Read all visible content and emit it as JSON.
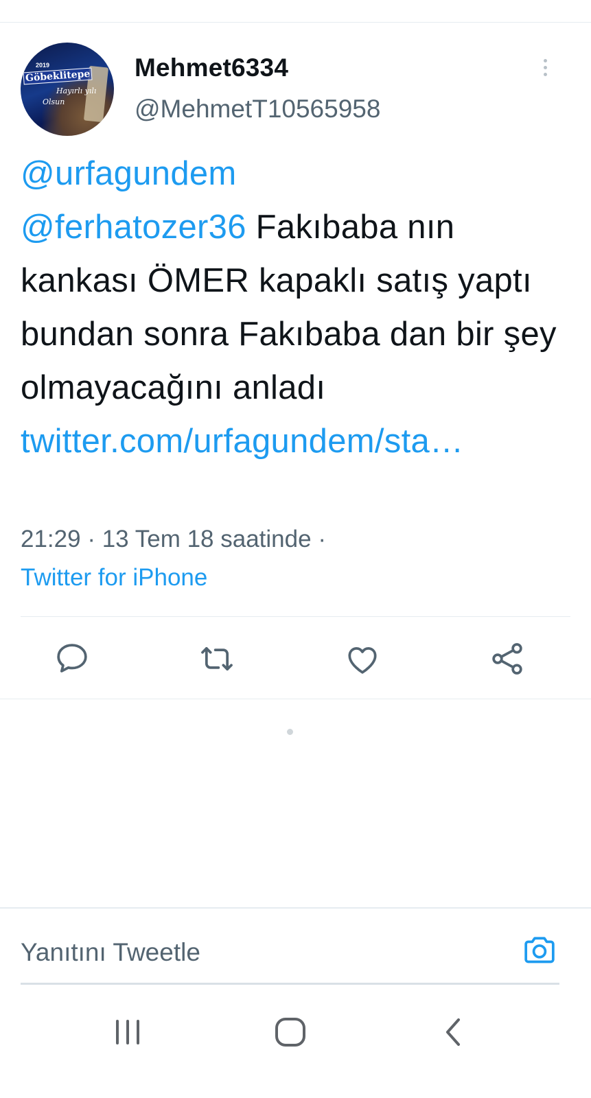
{
  "tweet": {
    "author": {
      "display_name": "Mehmet6334",
      "handle": "@MehmetT10565958",
      "avatar": {
        "year": "2019",
        "title": "Göbeklitepe",
        "line2": "Hayırlı yılı",
        "line3": "Olsun"
      }
    },
    "text": {
      "mention1": "@urfagundem",
      "mention2": "@ferhatozer36",
      "body": " Fakıbaba nın kankası ÖMER kapaklı satış yaptı bundan sonra Fakıbaba dan bir şey olmayacağını anladı ",
      "link": "twitter.com/urfagundem/sta…"
    },
    "meta": {
      "time": "21:29",
      "separator": "·",
      "date": "13 Tem 18 saatinde",
      "source": "Twitter for iPhone"
    }
  },
  "actions": {
    "reply_icon": "speech-bubble-icon",
    "retweet_icon": "retweet-icon",
    "like_icon": "heart-icon",
    "share_icon": "share-icon"
  },
  "reply_bar": {
    "placeholder": "Yanıtını Tweetle",
    "camera_icon": "camera-icon"
  },
  "colors": {
    "link": "#1d9bf0",
    "text": "#0f1419",
    "secondary": "#536471",
    "icon": "#536471",
    "divider": "#e6ecf0"
  },
  "system_nav": {
    "recents_icon": "recent-apps-icon",
    "home_icon": "home-icon",
    "back_icon": "back-icon"
  }
}
